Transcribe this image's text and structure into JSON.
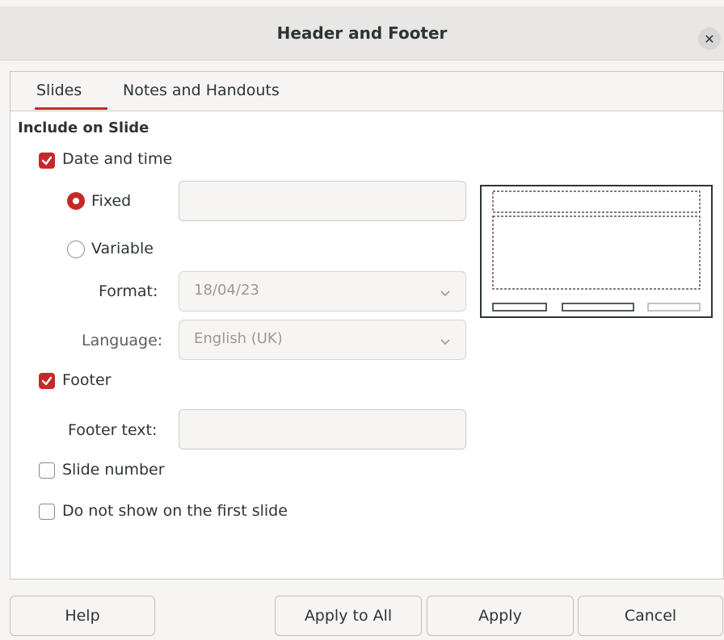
{
  "dialog": {
    "title": "Header and Footer"
  },
  "tabs": [
    {
      "label": "Slides"
    },
    {
      "label": "Notes and Handouts"
    }
  ],
  "section": {
    "title": "Include on Slide"
  },
  "date_time": {
    "label": "Date and time",
    "checked": true,
    "fixed_label": "Fixed",
    "fixed_value": "",
    "variable_label": "Variable",
    "format_label": "Format:",
    "format_value": "18/04/23",
    "language_label": "Language:",
    "language_value": "English (UK)"
  },
  "footer": {
    "label": "Footer",
    "checked": true,
    "text_label": "Footer text:",
    "text_value": ""
  },
  "slide_number": {
    "label": "Slide number",
    "checked": false
  },
  "first_slide": {
    "label": "Do not show on the first slide",
    "checked": false
  },
  "buttons": {
    "help": "Help",
    "apply_all": "Apply to All",
    "apply": "Apply",
    "cancel": "Cancel"
  },
  "colors": {
    "accent": "#c62828"
  }
}
